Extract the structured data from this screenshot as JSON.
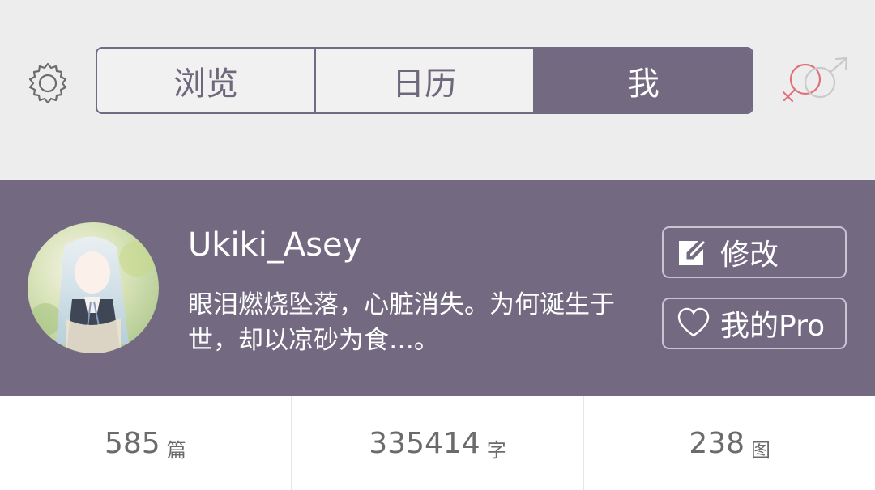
{
  "topbar": {
    "settings_icon": "gear-icon",
    "gender_icon": "gender-symbol-icon",
    "tabs": [
      {
        "label": "浏览",
        "active": false
      },
      {
        "label": "日历",
        "active": false
      },
      {
        "label": "我",
        "active": true
      }
    ]
  },
  "profile": {
    "username": "Ukiki_Asey",
    "bio": "眼泪燃烧坠落，心脏消失。为何诞生于世，却以凉砂为食…。",
    "edit_button": {
      "label": "修改",
      "icon": "edit-icon"
    },
    "pro_button": {
      "label": "我的Pro",
      "icon": "heart-icon"
    }
  },
  "stats": [
    {
      "value": "585",
      "unit": "篇"
    },
    {
      "value": "335414",
      "unit": "字"
    },
    {
      "value": "238",
      "unit": "图"
    }
  ],
  "colors": {
    "accent": "#736a81",
    "topbar_bg": "#eeeded",
    "gender_female": "#e0707a",
    "gender_male": "#c9c9c9"
  }
}
